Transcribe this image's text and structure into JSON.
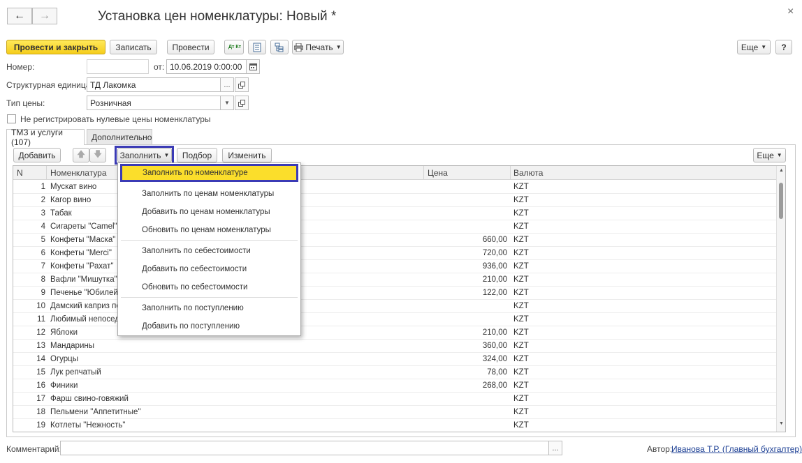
{
  "window": {
    "title": "Установка цен номенклатуры: Новый *",
    "back_icon": "←",
    "forward_icon": "→",
    "close_icon": "×"
  },
  "toolbar": {
    "post_close": "Провести и закрыть",
    "save": "Записать",
    "post": "Провести",
    "dt_kt": "Дт Кт",
    "print": "Печать",
    "more": "Еще",
    "help": "?"
  },
  "form": {
    "number_label": "Номер:",
    "number_value": "",
    "from_label": "от:",
    "date_value": "10.06.2019  0:00:00",
    "unit_label": "Структурная единица:",
    "unit_value": "ТД Лакомка",
    "price_type_label": "Тип цены:",
    "price_type_value": "Розничная",
    "zero_prices_label": "Не регистрировать нулевые цены номенклатуры",
    "zero_prices_checked": false
  },
  "tabs": [
    {
      "label": "ТМЗ и услуги (107)",
      "active": true
    },
    {
      "label": "Дополнительно",
      "active": false
    }
  ],
  "table_toolbar": {
    "add": "Добавить",
    "fill": "Заполнить",
    "pick": "Подбор",
    "change": "Изменить",
    "more": "Еще"
  },
  "columns": {
    "n": "N",
    "item": "Номенклатура",
    "price": "Цена",
    "currency": "Валюта"
  },
  "rows": [
    {
      "n": "1",
      "name": "Мускат вино",
      "price": "",
      "currency": "KZT"
    },
    {
      "n": "2",
      "name": "Кагор вино",
      "price": "",
      "currency": "KZT"
    },
    {
      "n": "3",
      "name": "Табак",
      "price": "",
      "currency": "KZT"
    },
    {
      "n": "4",
      "name": "Сигареты \"Camel\"",
      "price": "",
      "currency": "KZT"
    },
    {
      "n": "5",
      "name": "Конфеты \"Маска\"",
      "price": "660,00",
      "currency": "KZT"
    },
    {
      "n": "6",
      "name": "Конфеты \"Merci\"",
      "price": "720,00",
      "currency": "KZT"
    },
    {
      "n": "7",
      "name": "Конфеты \"Рахат\"",
      "price": "936,00",
      "currency": "KZT"
    },
    {
      "n": "8",
      "name": "Вафли \"Мишутка\"",
      "price": "210,00",
      "currency": "KZT"
    },
    {
      "n": "9",
      "name": "Печенье \"Юбилейн",
      "price": "122,00",
      "currency": "KZT"
    },
    {
      "n": "10",
      "name": "Дамский каприз пе",
      "price": "",
      "currency": "KZT"
    },
    {
      "n": "11",
      "name": "Любимый непосед",
      "price": "",
      "currency": "KZT"
    },
    {
      "n": "12",
      "name": "Яблоки",
      "price": "210,00",
      "currency": "KZT"
    },
    {
      "n": "13",
      "name": "Мандарины",
      "price": "360,00",
      "currency": "KZT"
    },
    {
      "n": "14",
      "name": "Огурцы",
      "price": "324,00",
      "currency": "KZT"
    },
    {
      "n": "15",
      "name": "Лук репчатый",
      "price": "78,00",
      "currency": "KZT"
    },
    {
      "n": "16",
      "name": "Финики",
      "price": "268,00",
      "currency": "KZT"
    },
    {
      "n": "17",
      "name": "Фарш свино-говяжий",
      "price": "",
      "currency": "KZT"
    },
    {
      "n": "18",
      "name": "Пельмени \"Аппетитные\"",
      "price": "",
      "currency": "KZT"
    },
    {
      "n": "19",
      "name": "Котлеты \"Нежность\"",
      "price": "",
      "currency": "KZT"
    }
  ],
  "fill_menu": [
    "Заполнить по номенклатуре",
    "Заполнить по ценам номенклатуры",
    "Добавить по ценам номенклатуры",
    "Обновить по ценам номенклатуры",
    "Заполнить по себестоимости",
    "Добавить по себестоимости",
    "Обновить по себестоимости",
    "Заполнить по поступлению",
    "Добавить по поступлению"
  ],
  "footer": {
    "comment_label": "Комментарий:",
    "comment_value": "",
    "author_label": "Автор:",
    "author_value": "Иванова Т.Р. (Главный бухгалтер)"
  }
}
